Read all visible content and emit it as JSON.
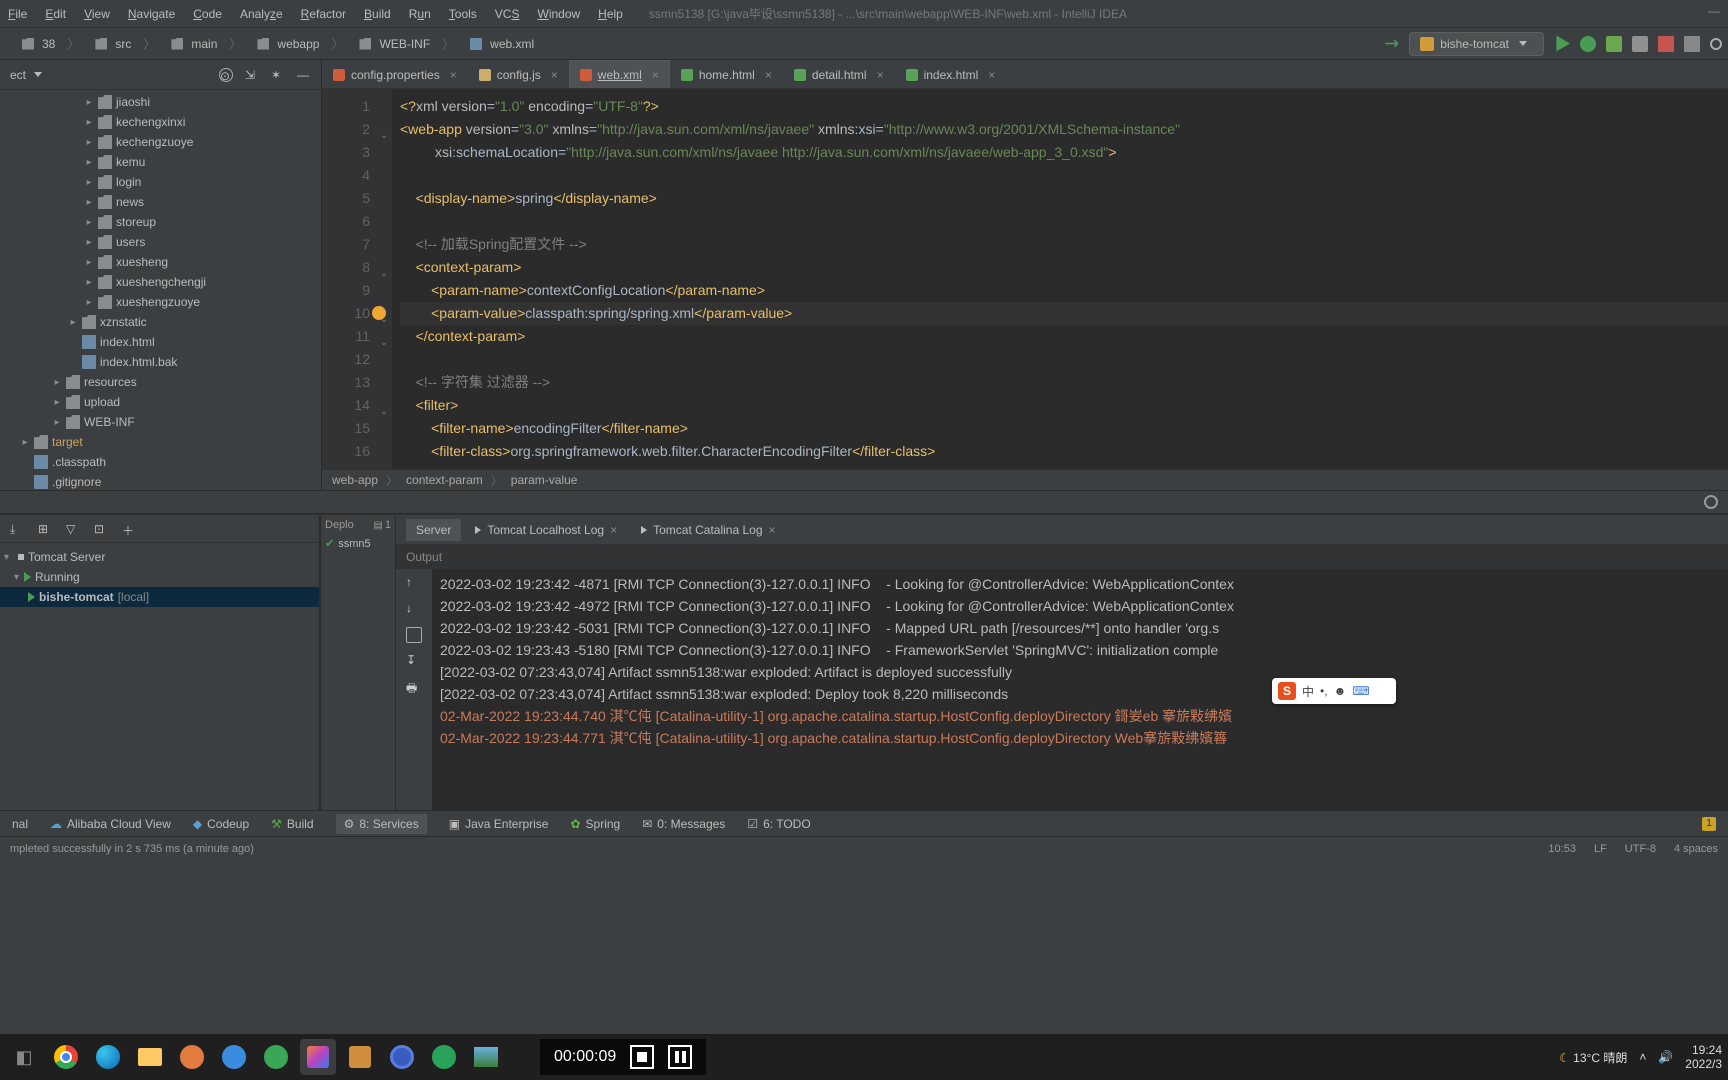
{
  "menu": {
    "file": "File",
    "edit": "Edit",
    "view": "View",
    "navigate": "Navigate",
    "code": "Code",
    "analyze": "Analyze",
    "refactor": "Refactor",
    "build": "Build",
    "run": "Run",
    "tools": "Tools",
    "vcs": "VCS",
    "window": "Window",
    "help": "Help"
  },
  "window_title": "ssmn5138 [G:\\java毕设\\ssmn5138] - ...\\src\\main\\webapp\\WEB-INF\\web.xml - IntelliJ IDEA",
  "breadcrumbs": [
    "38",
    "src",
    "main",
    "webapp",
    "WEB-INF",
    "web.xml"
  ],
  "run_selector": "bishe-tomcat",
  "project": {
    "selector": "ect",
    "items": [
      {
        "n": "jiaoshi",
        "t": "folder",
        "d": 5,
        "a": "col"
      },
      {
        "n": "kechengxinxi",
        "t": "folder",
        "d": 5,
        "a": "col"
      },
      {
        "n": "kechengzuoye",
        "t": "folder",
        "d": 5,
        "a": "col"
      },
      {
        "n": "kemu",
        "t": "folder",
        "d": 5,
        "a": "col"
      },
      {
        "n": "login",
        "t": "folder",
        "d": 5,
        "a": "col"
      },
      {
        "n": "news",
        "t": "folder",
        "d": 5,
        "a": "col"
      },
      {
        "n": "storeup",
        "t": "folder",
        "d": 5,
        "a": "col"
      },
      {
        "n": "users",
        "t": "folder",
        "d": 5,
        "a": "col"
      },
      {
        "n": "xuesheng",
        "t": "folder",
        "d": 5,
        "a": "col"
      },
      {
        "n": "xueshengchengji",
        "t": "folder",
        "d": 5,
        "a": "col"
      },
      {
        "n": "xueshengzuoye",
        "t": "folder",
        "d": 5,
        "a": "col"
      },
      {
        "n": "xznstatic",
        "t": "folder",
        "d": 4,
        "a": "col"
      },
      {
        "n": "index.html",
        "t": "file",
        "d": 4,
        "a": "none"
      },
      {
        "n": "index.html.bak",
        "t": "file",
        "d": 4,
        "a": "none"
      },
      {
        "n": "resources",
        "t": "folder",
        "d": 3,
        "a": "col"
      },
      {
        "n": "upload",
        "t": "folder",
        "d": 3,
        "a": "col"
      },
      {
        "n": "WEB-INF",
        "t": "folder",
        "d": 3,
        "a": "col"
      },
      {
        "n": "target",
        "t": "folder",
        "d": 1,
        "a": "col",
        "hl": true
      },
      {
        "n": ".classpath",
        "t": "file",
        "d": 1,
        "a": "none"
      },
      {
        "n": ".gitignore",
        "t": "file",
        "d": 1,
        "a": "none"
      }
    ]
  },
  "tabs": [
    {
      "label": "config.properties",
      "ico": "xml"
    },
    {
      "label": "config.js",
      "ico": "js"
    },
    {
      "label": "web.xml",
      "ico": "xml",
      "active": true
    },
    {
      "label": "home.html",
      "ico": "html"
    },
    {
      "label": "detail.html",
      "ico": "html"
    },
    {
      "label": "index.html",
      "ico": "html"
    }
  ],
  "editor": {
    "lines": [
      "1",
      "2",
      "3",
      "4",
      "5",
      "6",
      "7",
      "8",
      "9",
      "10",
      "11",
      "12",
      "13",
      "14",
      "15",
      "16"
    ],
    "caret_line": 10,
    "bulb_line": 10
  },
  "code_breadcrumbs": [
    "web-app",
    "context-param",
    "param-value"
  ],
  "run": {
    "server_header": "Tomcat Server",
    "running": "Running",
    "item": "bishe-tomcat",
    "item_suffix": "[local]",
    "tabs": [
      {
        "label": "Server",
        "active": true
      },
      {
        "label": "Tomcat Localhost Log"
      },
      {
        "label": "Tomcat Catalina Log"
      }
    ],
    "depl_head": "Deplo",
    "depl_count": "1",
    "depl_item": "ssmn5",
    "output_label": "Output",
    "logs": [
      "2022-03-02 19:23:42 -4871 [RMI TCP Connection(3)-127.0.0.1] INFO    - Looking for @ControllerAdvice: WebApplicationContex",
      "2022-03-02 19:23:42 -4972 [RMI TCP Connection(3)-127.0.0.1] INFO    - Looking for @ControllerAdvice: WebApplicationContex",
      "2022-03-02 19:23:42 -5031 [RMI TCP Connection(3)-127.0.0.1] INFO    - Mapped URL path [/resources/**] onto handler 'org.s",
      "2022-03-02 19:23:43 -5180 [RMI TCP Connection(3)-127.0.0.1] INFO    - FrameworkServlet 'SpringMVC': initialization comple",
      "[2022-03-02 07:23:43,074] Artifact ssmn5138:war exploded: Artifact is deployed successfully",
      "[2022-03-02 07:23:43,074] Artifact ssmn5138:war exploded: Deploy took 8,220 milliseconds"
    ],
    "warns": [
      "02-Mar-2022 19:23:44.740 淇℃伅 [Catalina-utility-1] org.apache.catalina.startup.HostConfig.deployDirectory 鎶妛eb 搴旂敤绋嬪",
      "02-Mar-2022 19:23:44.771 淇℃伅 [Catalina-utility-1] org.apache.catalina.startup.HostConfig.deployDirectory Web搴旂敤绋嬪簭"
    ]
  },
  "bottom_tabs": {
    "terminal": "nal",
    "aliyun": "Alibaba Cloud View",
    "codeup": "Codeup",
    "build": "Build",
    "services": "8: Services",
    "jee": "Java Enterprise",
    "spring": "Spring",
    "messages": "0: Messages",
    "todo": "6: TODO"
  },
  "status": {
    "msg": "mpleted successfully in 2 s 735 ms (a minute ago)",
    "pos": "10:53",
    "lf": "LF",
    "enc": "UTF-8",
    "ind": "4 spaces"
  },
  "media": {
    "time": "00:00:09"
  },
  "systray": {
    "weather": "13°C 晴朗",
    "time": "19:24",
    "date": "2022/3"
  },
  "ime": "中"
}
